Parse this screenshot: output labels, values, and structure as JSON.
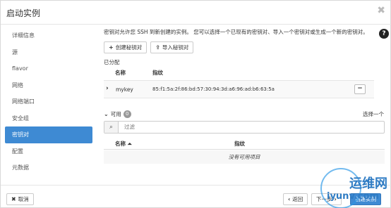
{
  "dialog": {
    "title": "启动实例",
    "close_glyph": "✖"
  },
  "sidebar": {
    "items": [
      {
        "label": "详细信息"
      },
      {
        "label": "源"
      },
      {
        "label": "flavor"
      },
      {
        "label": "网络"
      },
      {
        "label": "网络端口"
      },
      {
        "label": "安全组"
      },
      {
        "label": "密钥对"
      },
      {
        "label": "配置"
      },
      {
        "label": "元数据"
      }
    ],
    "active_index": 6
  },
  "content": {
    "intro": "密钥对允许您 SSH 到新创建的实例。 您可以选择一个已现有的密钥对、导入一个密钥对或生成一个新的密钥对。",
    "create_button": "创建秘钥对",
    "import_button": "导入秘钥对",
    "assigned_label": "已分配",
    "columns": {
      "name": "名称",
      "fingerprint": "指纹"
    },
    "assigned_rows": [
      {
        "name": "mykey",
        "fingerprint": "85:f1:5a:2f:86:bd:57:30:94:3d:a6:96:ad:b6:63:5a"
      }
    ],
    "available_label": "可用",
    "available_count": "0",
    "select_one": "选择一个",
    "filter_placeholder": "过滤",
    "available_columns": {
      "name": "名称",
      "fingerprint": "指纹"
    },
    "empty_text": "没有可用项目"
  },
  "footer": {
    "cancel": "取消",
    "back": "返回",
    "next": "下一步",
    "launch": "创建实例"
  },
  "watermark": {
    "line1": "运维网",
    "line2": "iyunv.com"
  },
  "colors": {
    "accent": "#3e8ad3"
  }
}
